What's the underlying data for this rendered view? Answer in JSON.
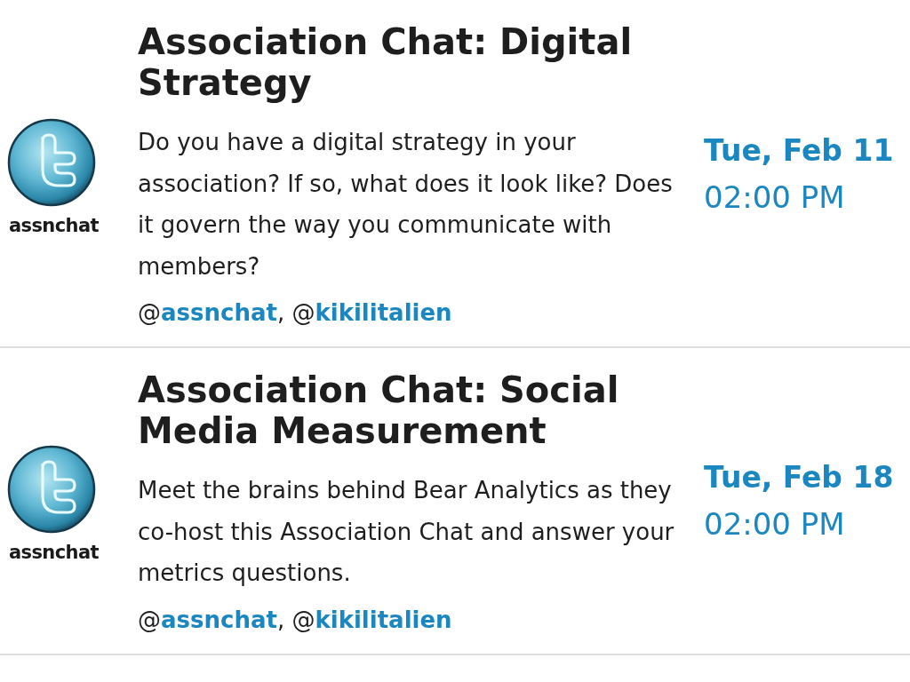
{
  "events": [
    {
      "logo": {
        "caption": "assnchat"
      },
      "title": "Association Chat: Digital Strategy",
      "description": "Do you have a digital strategy in your association? If so, what does it look like? Does it govern the way you communicate with members?",
      "hosts": {
        "separator": ",",
        "items": [
          {
            "prefix": "@",
            "handle": "assnchat"
          },
          {
            "prefix": "@",
            "handle": "kikilitalien"
          }
        ]
      },
      "date": "Tue, Feb 11",
      "time": "02:00 PM"
    },
    {
      "logo": {
        "caption": "assnchat"
      },
      "title": "Association Chat: Social Media Measurement",
      "description": "Meet the brains behind Bear Analytics as they co-host this Association Chat and answer your metrics questions.",
      "hosts": {
        "separator": ",",
        "items": [
          {
            "prefix": "@",
            "handle": "assnchat"
          },
          {
            "prefix": "@",
            "handle": "kikilitalien"
          }
        ]
      },
      "date": "Tue, Feb 18",
      "time": "02:00 PM"
    }
  ]
}
